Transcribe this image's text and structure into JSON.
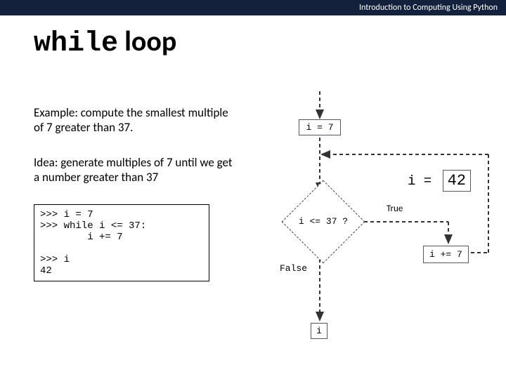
{
  "header": "Introduction to Computing Using Python",
  "title_mono": "while",
  "title_rest": " loop",
  "para1": "Example: compute the smallest multiple of 7 greater than 37.",
  "para2": "Idea: generate multiples of 7 until we get a number greater than 37",
  "code": ">>> i = 7\n>>> while i <= 37:\n        i += 7\n\n>>> i\n42",
  "flow": {
    "init": "i = 7",
    "cond": "i <= 37 ?",
    "true": "True",
    "false": "False",
    "inc": "i += 7",
    "end": "i",
    "state_prefix": "i = ",
    "state_val": "42"
  }
}
